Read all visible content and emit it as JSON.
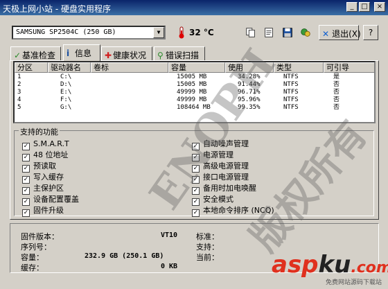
{
  "window": {
    "title": "硬盘实用程序",
    "title_overlay": "天极上网小站 - 硬盘实用程序",
    "controls": [
      "minimize",
      "maximize",
      "close"
    ]
  },
  "toolbar": {
    "drive_selector": "SAMSUNG SP2504C (250 GB)",
    "temperature": "32 °C",
    "exit_label": "退出(X)",
    "help_label": "?",
    "icons": [
      "copy-icon",
      "document-icon",
      "save-icon",
      "refresh-icon"
    ]
  },
  "tabs": [
    {
      "label": "基准检查",
      "icon": "check-icon"
    },
    {
      "label": "信息",
      "icon": "info-icon",
      "active": true
    },
    {
      "label": "健康状况",
      "icon": "cross-icon"
    },
    {
      "label": "错误扫描",
      "icon": "magnifier-icon"
    }
  ],
  "partition_table": {
    "headers": [
      "分区",
      "驱动器名",
      "卷标",
      "容量",
      "使用",
      "类型",
      "可引导"
    ],
    "rows": [
      [
        "1",
        "C:\\",
        "",
        "15005 MB",
        "34.28%",
        "NTFS",
        "是"
      ],
      [
        "2",
        "D:\\",
        "",
        "15005 MB",
        "91.44%",
        "NTFS",
        "否"
      ],
      [
        "3",
        "E:\\",
        "",
        "49999 MB",
        "96.71%",
        "NTFS",
        "否"
      ],
      [
        "4",
        "F:\\",
        "",
        "49999 MB",
        "95.96%",
        "NTFS",
        "否"
      ],
      [
        "5",
        "G:\\",
        "",
        "108464 MB",
        "99.35%",
        "NTFS",
        "否"
      ]
    ]
  },
  "features": {
    "title": "支持的功能",
    "left": [
      "S.M.A.R.T",
      "48 位地址",
      "预读取",
      "写入缓存",
      "主保护区",
      "设备配置覆盖",
      "固件升级"
    ],
    "right": [
      "自动噪声管理",
      "电源管理",
      "高级电源管理",
      "接口电源管理",
      "备用时加电唤醒",
      "安全模式",
      "本地命令排序 (NCQ)"
    ]
  },
  "info": {
    "firmware_label": "固件版本：",
    "firmware_value": "VT10",
    "serial_label": "序列号：",
    "serial_value": "",
    "capacity_label": "容量：",
    "capacity_value": "232.9 GB (250.1 GB)",
    "buffer_label": "缓存：",
    "buffer_value": "0 KB",
    "standard_label": "标准：",
    "support_label": "支持：",
    "current_label": "当前："
  },
  "watermark": {
    "text1": "ENOPH",
    "text2": "版权所有",
    "brand_asp": "asp",
    "brand_ku": "ku",
    "brand_tld": ".com",
    "brand_sub": "免费网站源码下载站"
  }
}
